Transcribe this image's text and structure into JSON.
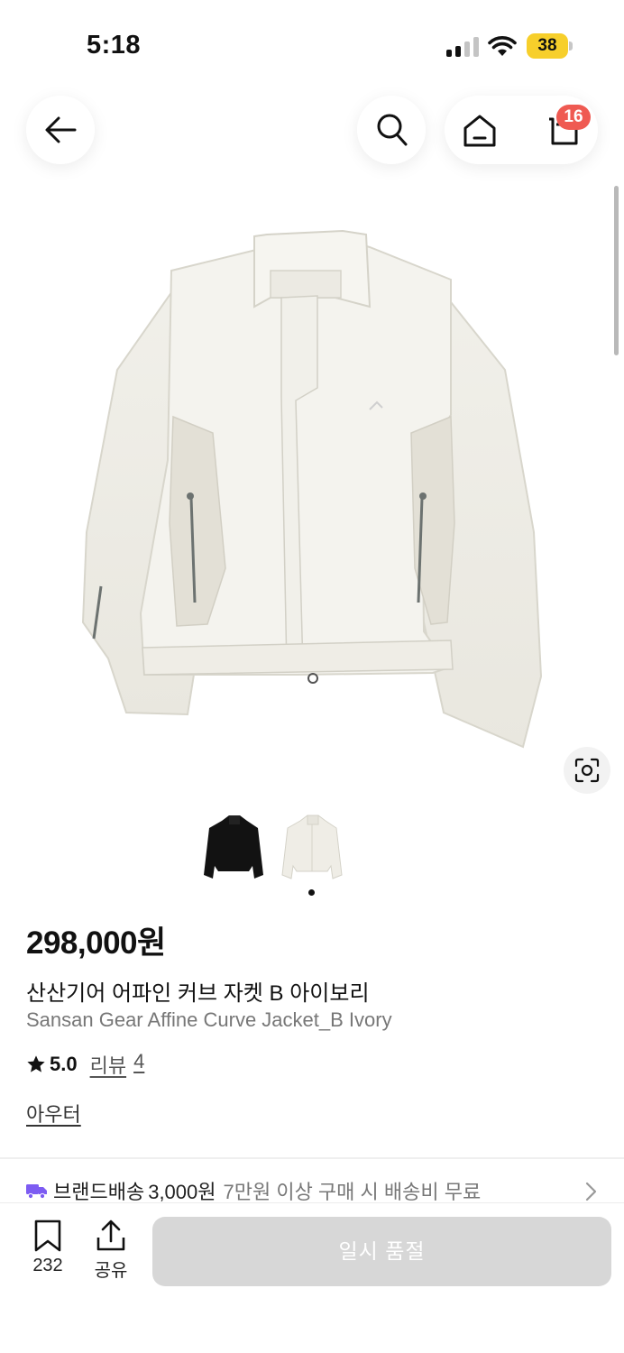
{
  "status_bar": {
    "time": "5:18",
    "battery": "38",
    "battery_color": "#f7cf2b"
  },
  "header": {
    "back_icon": "arrow-left-icon",
    "search_icon": "search-icon",
    "home_icon": "home-icon",
    "cart_icon": "cart-icon",
    "cart_count": "16",
    "badge_color": "#ef5a52"
  },
  "gallery": {
    "thumbnails": [
      {
        "name": "black-jacket-thumbnail"
      },
      {
        "name": "ivory-jacket-thumbnail"
      }
    ],
    "selected_index": 1,
    "lens_icon": "visual-search-icon"
  },
  "product": {
    "price": "298,000원",
    "name_ko": "산산기어 어파인 커브 자켓 B 아이보리",
    "name_en": "Sansan Gear Affine Curve Jacket_B Ivory",
    "rating": "5.0",
    "review_label": "리뷰",
    "review_count": "4",
    "category": "아우터"
  },
  "shipping": {
    "label": "브랜드배송",
    "fee": "3,000원",
    "note": "7만원 이상 구매 시 배송비 무료"
  },
  "bottom_bar": {
    "bookmark_count": "232",
    "share_label": "공유",
    "buy_label": "일시 품절",
    "buy_button_color": "#d7d7d7"
  }
}
